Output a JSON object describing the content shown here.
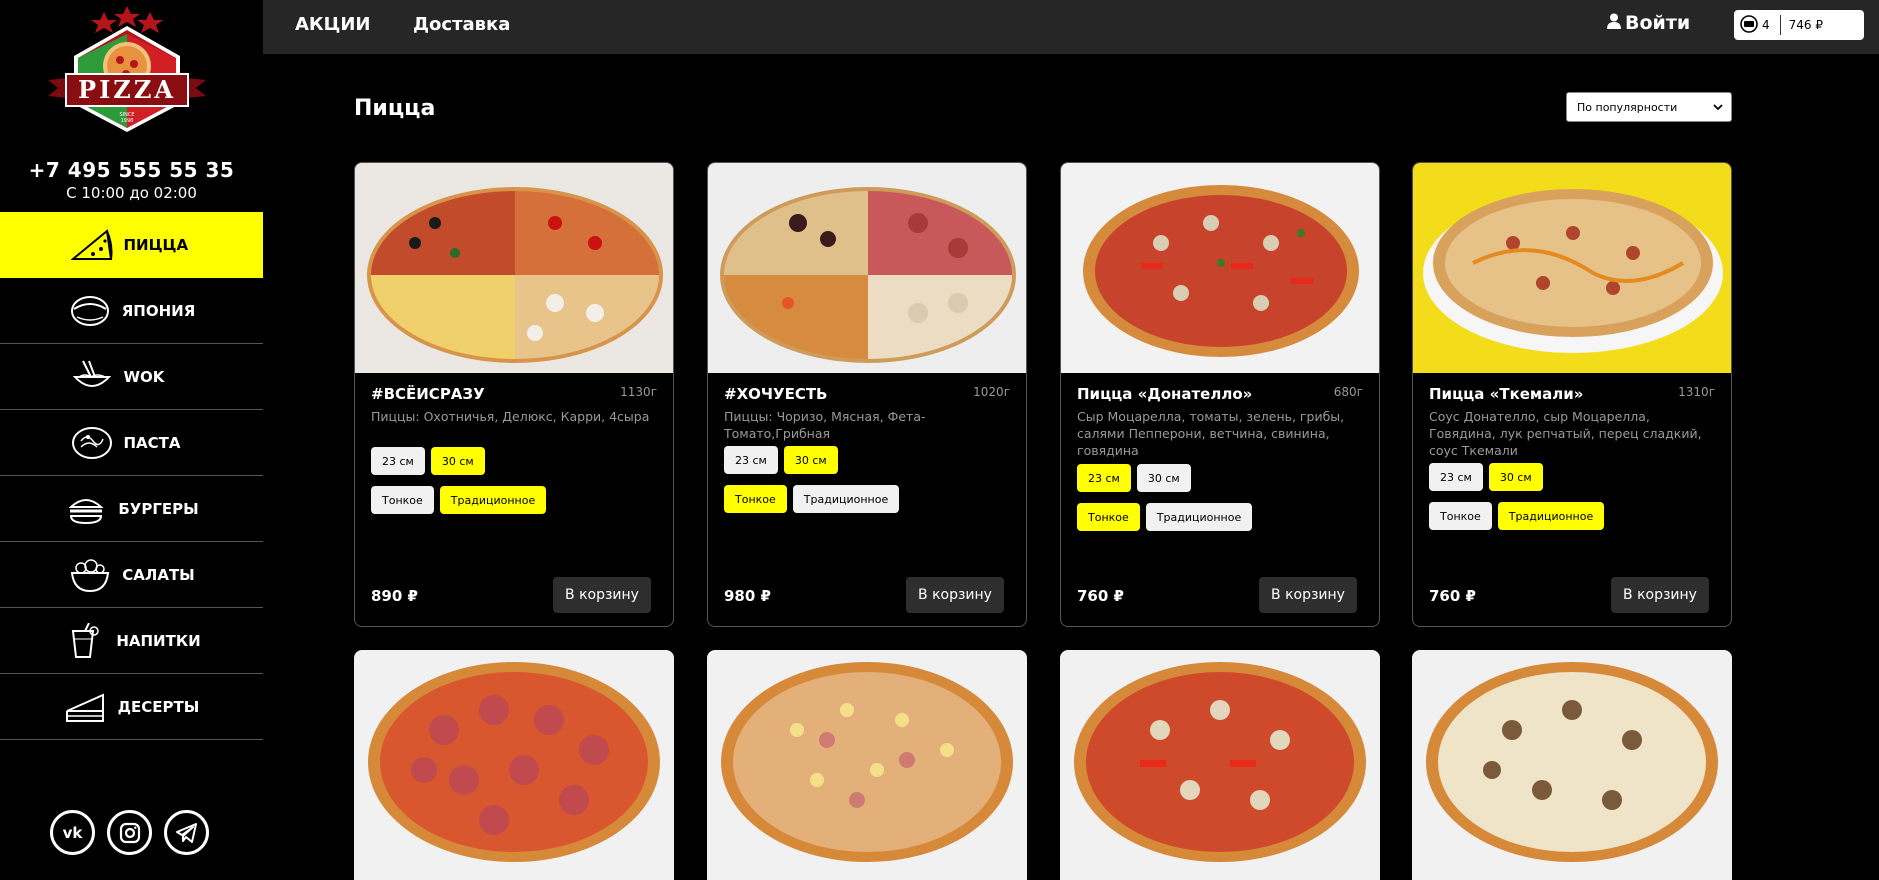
{
  "brand": {
    "logo_text": "PIZZA",
    "logo_since": "SINCE 1998",
    "phone": "+7 495 555 55 35",
    "hours": "С 10:00 до 02:00"
  },
  "nav": [
    {
      "label": "ПИЦЦА",
      "icon": "pizza-slice-icon",
      "active": true
    },
    {
      "label": "ЯПОНИЯ",
      "icon": "sushi-icon",
      "active": false
    },
    {
      "label": "WOK",
      "icon": "wok-noodles-icon",
      "active": false
    },
    {
      "label": "ПАСТА",
      "icon": "pasta-icon",
      "active": false
    },
    {
      "label": "БУРГЕРЫ",
      "icon": "burger-icon",
      "active": false
    },
    {
      "label": "САЛАТЫ",
      "icon": "salad-bowl-icon",
      "active": false
    },
    {
      "label": "НАПИТКИ",
      "icon": "drink-icon",
      "active": false
    },
    {
      "label": "ДЕСЕРТЫ",
      "icon": "cake-slice-icon",
      "active": false
    }
  ],
  "socials": [
    {
      "icon": "vk-icon",
      "glyph": "vk"
    },
    {
      "icon": "instagram-icon",
      "glyph": ""
    },
    {
      "icon": "telegram-icon",
      "glyph": ""
    }
  ],
  "topbar": {
    "promo": "АКЦИИ",
    "delivery": "Доставка",
    "login": "Войти",
    "cart_count": "4",
    "cart_sum": "746 ₽"
  },
  "main": {
    "title": "Пицца",
    "sort_selected": "По популярности"
  },
  "products": [
    {
      "name": "#ВСЁИСРАЗУ",
      "weight": "1130г",
      "desc": "Пиццы: Охотничья, Делюкс, Карри, 4сыра",
      "sizes": [
        "23 см",
        "30 см"
      ],
      "size_sel": 1,
      "doughs": [
        "Тонкое",
        "Традиционное"
      ],
      "dough_sel": 1,
      "price": "890 ₽",
      "buy": "В корзину"
    },
    {
      "name": "#ХОЧУЕСТЬ",
      "weight": "1020г",
      "desc": "Пиццы: Чоризо, Мясная, Фета-Томато,Грибная",
      "sizes": [
        "23 см",
        "30 см"
      ],
      "size_sel": 1,
      "doughs": [
        "Тонкое",
        "Традиционное"
      ],
      "dough_sel": 0,
      "price": "980 ₽",
      "buy": "В корзину"
    },
    {
      "name": "Пицца «Донателло»",
      "weight": "680г",
      "desc": "Сыр Моцарелла, томаты, зелень, грибы, салями Пепперони, ветчина, свинина, говядина",
      "sizes": [
        "23 см",
        "30 см"
      ],
      "size_sel": 0,
      "doughs": [
        "Тонкое",
        "Традиционное"
      ],
      "dough_sel": 0,
      "price": "760 ₽",
      "buy": "В корзину"
    },
    {
      "name": "Пицца «Ткемали»",
      "weight": "1310г",
      "desc": "Соус Донателло, сыр Моцарелла, Говядина, лук репчатый, перец сладкий, соус Ткемали",
      "sizes": [
        "23 см",
        "30 см"
      ],
      "size_sel": 1,
      "doughs": [
        "Тонкое",
        "Традиционное"
      ],
      "dough_sel": 1,
      "price": "760 ₽",
      "buy": "В корзину"
    }
  ],
  "colors": {
    "accent": "#ffff00",
    "topbar": "#262626",
    "background": "#000000"
  }
}
